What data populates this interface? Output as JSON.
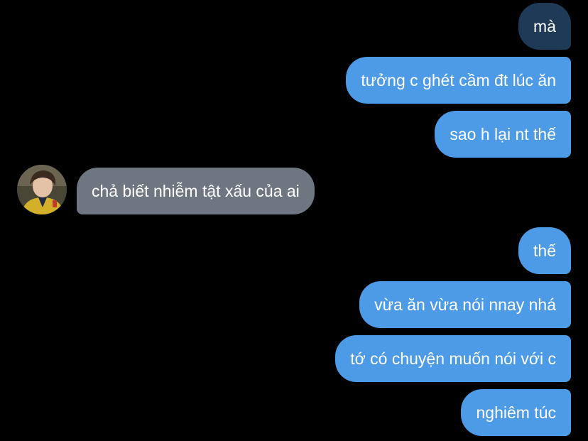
{
  "messages": [
    {
      "text": "mà",
      "side": "sent",
      "tone": "dark"
    },
    {
      "text": "tưởng c ghét cầm đt lúc ăn",
      "side": "sent",
      "tone": "blue"
    },
    {
      "text": "sao h lại nt thế",
      "side": "sent",
      "tone": "blue"
    },
    {
      "text": "chả biết nhiễm tật xấu của ai",
      "side": "received",
      "tone": "gray"
    },
    {
      "text": "thế",
      "side": "sent",
      "tone": "blue"
    },
    {
      "text": "vừa ăn vừa nói nnay nhá",
      "side": "sent",
      "tone": "blue"
    },
    {
      "text": "tớ có chuyện muốn nói với c",
      "side": "sent",
      "tone": "blue"
    },
    {
      "text": "nghiêm túc",
      "side": "sent",
      "tone": "blue"
    }
  ],
  "avatar": {
    "icon": "profile-photo"
  },
  "colors": {
    "background": "#000000",
    "sent": "#4d9be6",
    "sent_dark": "#1e3a57",
    "received": "#6e7681",
    "text": "#ffffff"
  }
}
